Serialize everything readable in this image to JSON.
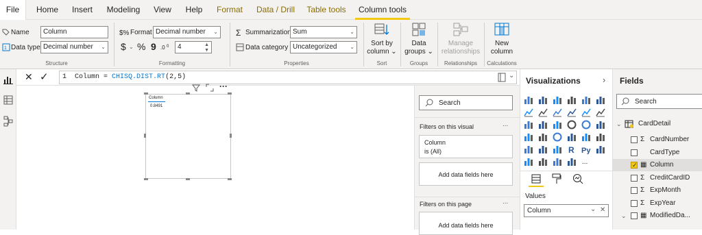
{
  "menu": {
    "file": "File",
    "home": "Home",
    "insert": "Insert",
    "modeling": "Modeling",
    "view": "View",
    "help": "Help",
    "format": "Format",
    "data_drill": "Data / Drill",
    "table_tools": "Table tools",
    "column_tools": "Column tools"
  },
  "ribbon": {
    "structure": {
      "name_label": "Name",
      "name_value": "Column",
      "datatype_label": "Data type",
      "datatype_value": "Decimal number",
      "group": "Structure"
    },
    "formatting": {
      "format_label": "Format",
      "format_value": "Decimal number",
      "currency_symbol": "$",
      "percent_symbol": "%",
      "comma_symbol": "9",
      "decimals_value": "4",
      "group": "Formatting"
    },
    "properties": {
      "summarization_label": "Summarization",
      "summarization_value": "Sum",
      "category_label": "Data category",
      "category_value": "Uncategorized",
      "group": "Properties"
    },
    "sort": {
      "line1": "Sort by",
      "line2": "column",
      "group": "Sort"
    },
    "groups": {
      "line1": "Data",
      "line2": "groups",
      "group": "Groups"
    },
    "relationships": {
      "line1": "Manage",
      "line2": "relationships",
      "group": "Relationships"
    },
    "calculations": {
      "line1": "New",
      "line2": "column",
      "group": "Calculations"
    }
  },
  "formula": {
    "line_no": "1",
    "prefix": "Column = ",
    "function": "CHISQ.DIST.RT",
    "args": "(2,5)"
  },
  "card": {
    "title": "Column",
    "value": "0.8491"
  },
  "filters": {
    "search_placeholder": "Search",
    "on_visual_title": "Filters on this visual",
    "filter_field": "Column",
    "filter_value": "is (All)",
    "add_fields": "Add data fields here",
    "on_page_title": "Filters on this page",
    "add_fields_page": "Add data fields here",
    "more": "..."
  },
  "visualizations": {
    "title": "Visualizations",
    "values_label": "Values",
    "values_field": "Column",
    "more": "..."
  },
  "fields": {
    "title": "Fields",
    "search_placeholder": "Search",
    "table_name": "CardDetail",
    "items": [
      {
        "label": "CardNumber",
        "checked": false,
        "sigma": true
      },
      {
        "label": "CardType",
        "checked": false,
        "sigma": false
      },
      {
        "label": "Column",
        "checked": true,
        "sigma": false
      },
      {
        "label": "CreditCardID",
        "checked": false,
        "sigma": true
      },
      {
        "label": "ExpMonth",
        "checked": false,
        "sigma": true
      },
      {
        "label": "ExpYear",
        "checked": false,
        "sigma": true
      },
      {
        "label": "ModifiedDa...",
        "checked": false,
        "sigma": false
      }
    ]
  },
  "colors": {
    "accent": "#f2c811",
    "context_tab": "#8a6d00",
    "dax_function": "#0078d4"
  }
}
